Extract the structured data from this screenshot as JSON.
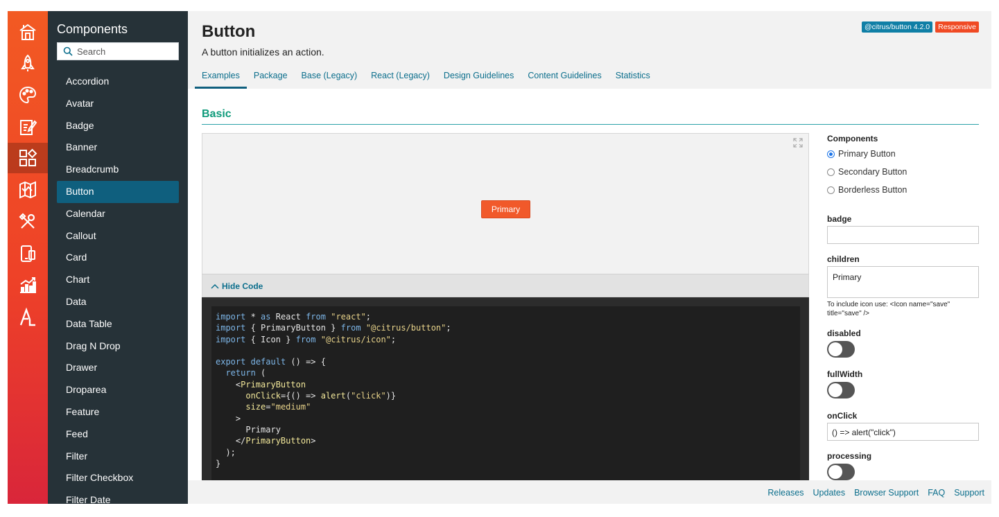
{
  "rail": {
    "icons": [
      "home-icon",
      "rocket-icon",
      "palette-icon",
      "edit-document-icon",
      "components-grid-icon",
      "map-icon",
      "tools-icon",
      "mobile-device-icon",
      "chart-icon",
      "accessibility-icon"
    ],
    "active_index": 4,
    "colors": {
      "top": "#f25a23",
      "bottom": "#d9263a"
    }
  },
  "sidebar": {
    "title": "Components",
    "search_placeholder": "Search",
    "items": [
      "Accordion",
      "Avatar",
      "Badge",
      "Banner",
      "Breadcrumb",
      "Button",
      "Calendar",
      "Callout",
      "Card",
      "Chart",
      "Data",
      "Data Table",
      "Drag N Drop",
      "Drawer",
      "Droparea",
      "Feature",
      "Feed",
      "Filter",
      "Filter Checkbox",
      "Filter Date"
    ],
    "active_item": "Button"
  },
  "header": {
    "title": "Button",
    "description": "A button initializes an action.",
    "badges": [
      {
        "label": "@citrus/button 4.2.0",
        "color": "#0f7fa6"
      },
      {
        "label": "Responsive",
        "color": "#f04a24"
      }
    ],
    "tabs": [
      "Examples",
      "Package",
      "Base (Legacy)",
      "React (Legacy)",
      "Design Guidelines",
      "Content Guidelines",
      "Statistics"
    ],
    "active_tab": "Examples"
  },
  "section": {
    "title": "Basic"
  },
  "preview": {
    "button_label": "Primary",
    "button_color": "#f1592a"
  },
  "code_toggle": {
    "label": "Hide Code"
  },
  "code": {
    "lines": [
      "import * as React from \"react\";",
      "import { PrimaryButton } from \"@citrus/button\";",
      "import { Icon } from \"@citrus/icon\";",
      "",
      "export default () => {",
      "  return (",
      "    <PrimaryButton",
      "      onClick={() => alert(\"click\")}",
      "      size=\"medium\"",
      "    >",
      "      Primary",
      "    </PrimaryButton>",
      "  );",
      "}"
    ]
  },
  "panel": {
    "components_label": "Components",
    "radio_options": [
      "Primary Button",
      "Secondary Button",
      "Borderless Button"
    ],
    "selected_option": "Primary Button",
    "badge_label": "badge",
    "badge_value": "",
    "children_label": "children",
    "children_value": "Primary",
    "children_help": "To include icon use: <Icon name=\"save\" title=\"save\" />",
    "disabled_label": "disabled",
    "fullwidth_label": "fullWidth",
    "onclick_label": "onClick",
    "onclick_value": "() => alert(\"click\")",
    "processing_label": "processing"
  },
  "footer": {
    "links": [
      "Releases",
      "Updates",
      "Browser Support",
      "FAQ",
      "Support"
    ]
  }
}
